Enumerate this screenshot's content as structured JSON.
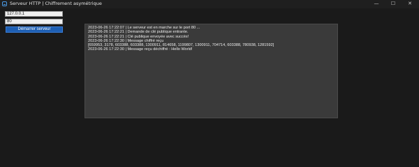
{
  "window": {
    "title": "Serveur HTTP | Chiffrement asymétrique",
    "icon": "server-window-icon",
    "controls": {
      "minimize": "—",
      "maximize": "☐",
      "close": "✕"
    }
  },
  "form": {
    "host_value": "127.0.0.1",
    "port_value": "80",
    "start_button_label": "Démarrer serveur",
    "button_color": "#1e5fb3"
  },
  "log": {
    "lines": [
      "2023-06-26 17:22:07 | Le serveur est en marche sur le port 80 ...",
      "2023-06-26 17:22:21 | Demande de clé publique entrante.",
      "2023-06-26 17:22:21 | Clé publique envoyée avec succès!",
      "2023-06-26 17:22:30 | Message chiffré reçu",
      "[659953, 3178, 603388, 603388, 1300911, 814658, 1199807, 1300911, 704714, 603388, 780938, 1281592]",
      "2023-06-26 17:22:30 | Message reçu déchiffré : Hello World!"
    ]
  }
}
